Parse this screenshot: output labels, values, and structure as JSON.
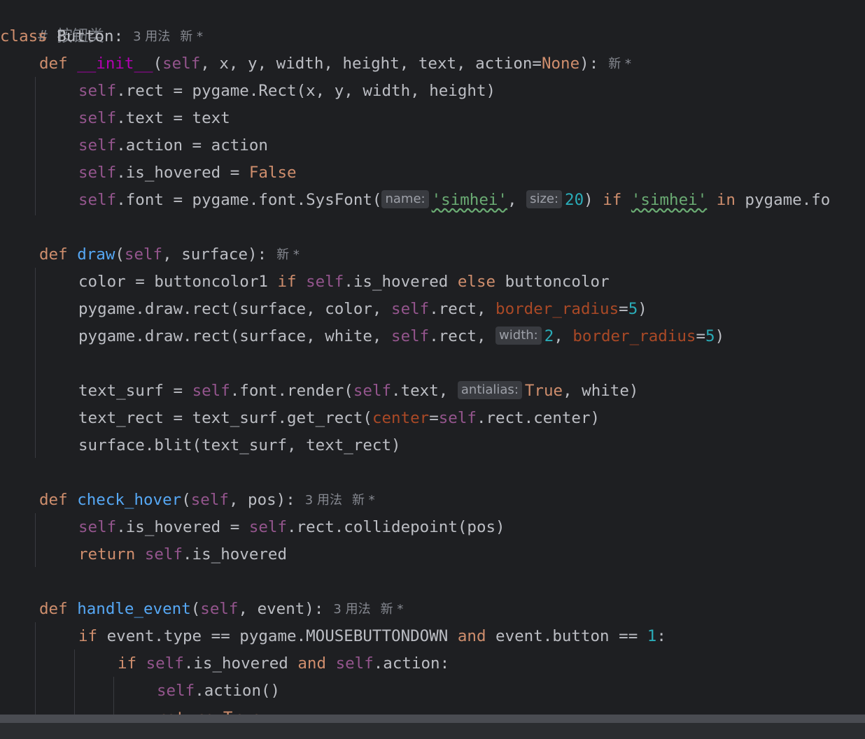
{
  "editor": {
    "language": "python",
    "colors": {
      "background": "#1e1f22",
      "keyword": "#cf8e6d",
      "self": "#94558d",
      "function": "#56a8f5",
      "dunder": "#b200b2",
      "string": "#6aab73",
      "number": "#2aacb8",
      "named_param": "#aa4926",
      "comment": "#7a7e85",
      "text": "#bcbec4"
    },
    "lines": [
      {
        "comment": "# 按钮类"
      },
      {
        "kw": "class",
        "name": "Button",
        "punct": ":",
        "lens_usages": "3 用法",
        "lens_new": "新 *"
      },
      {
        "kw": "def",
        "name": "__init__",
        "p_open": "(",
        "self": "self",
        "params": ", x, y, width, height, text, action=",
        "none": "None",
        "p_close": "):",
        "lens_new": "新 *"
      },
      {
        "self": "self",
        "rest": ".rect = pygame.Rect(x, y, width, height)"
      },
      {
        "self": "self",
        "rest": ".text = text"
      },
      {
        "self": "self",
        "rest": ".action = action"
      },
      {
        "self": "self",
        "rest": ".is_hovered = ",
        "val": "False"
      },
      {
        "self": "self",
        "a": ".font = pygame.font.SysFont(",
        "hint1": "name:",
        "s1": "'simhei'",
        "b": ", ",
        "hint2": "size:",
        "n": "20",
        "c": ") ",
        "if": "if",
        "d": " ",
        "s2": "'simhei'",
        "e": " ",
        "in": "in",
        "f": " pygame.fo"
      },
      {},
      {
        "kw": "def",
        "name": "draw",
        "p_open": "(",
        "self": "self",
        "params": ", surface):",
        "lens_new": "新 *"
      },
      {
        "a": "color = buttoncolor1 ",
        "if": "if",
        "b": " ",
        "self": "self",
        "c": ".is_hovered ",
        "else": "else",
        "d": " buttoncolor"
      },
      {
        "a": "pygame.draw.rect(surface, color, ",
        "self": "self",
        "b": ".rect, ",
        "param": "border_radius",
        "eq": "=",
        "n": "5",
        "c": ")"
      },
      {
        "a": "pygame.draw.rect(surface, white, ",
        "self": "self",
        "b": ".rect, ",
        "hint": "width:",
        "n1": "2",
        "c": ", ",
        "param": "border_radius",
        "eq": "=",
        "n2": "5",
        "d": ")"
      },
      {},
      {
        "a": "text_surf = ",
        "self1": "self",
        "b": ".font.render(",
        "self2": "self",
        "c": ".text, ",
        "hint": "antialias:",
        "val": "True",
        "d": ", white)"
      },
      {
        "a": "text_rect = text_surf.get_rect(",
        "param": "center",
        "eq": "=",
        "self": "self",
        "b": ".rect.center)"
      },
      {
        "a": "surface.blit(text_surf, text_rect)"
      },
      {},
      {
        "kw": "def",
        "name": "check_hover",
        "p_open": "(",
        "self": "self",
        "params": ", pos):",
        "lens_usages": "3 用法",
        "lens_new": "新 *"
      },
      {
        "self1": "self",
        "a": ".is_hovered = ",
        "self2": "self",
        "b": ".rect.collidepoint(pos)"
      },
      {
        "kw": "return",
        "a": " ",
        "self": "self",
        "b": ".is_hovered"
      },
      {},
      {
        "kw": "def",
        "name": "handle_event",
        "p_open": "(",
        "self": "self",
        "params": ", event):",
        "lens_usages": "3 用法",
        "lens_new": "新 *"
      },
      {
        "if": "if",
        "a": " event.type == pygame.MOUSEBUTTONDOWN ",
        "and": "and",
        "b": " event.button == ",
        "n": "1",
        "c": ":"
      },
      {
        "if": "if",
        "a": " ",
        "self1": "self",
        "b": ".is_hovered ",
        "and": "and",
        "c": " ",
        "self2": "self",
        "d": ".action:"
      },
      {
        "self": "self",
        "a": ".action()"
      },
      {
        "kw": "return",
        "a": " ",
        "val": "True"
      }
    ]
  },
  "scrollbar": {
    "orientation": "horizontal"
  }
}
